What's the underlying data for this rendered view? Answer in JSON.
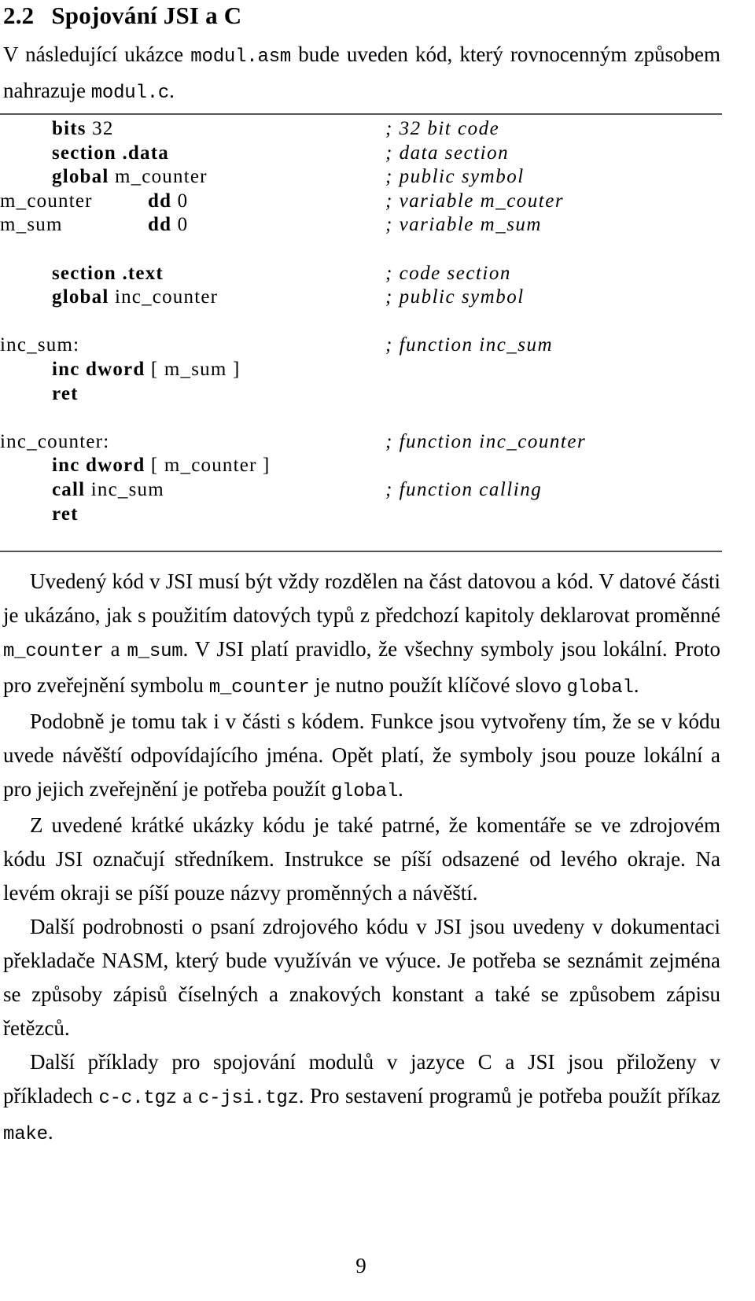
{
  "heading": {
    "number": "2.2",
    "title": "Spojování JSI a C"
  },
  "intro": {
    "part1": "V následující ukázce ",
    "code1": "modul.asm",
    "part2": " bude uveden kód, který rovnocenným způsobem nahrazuje ",
    "code2": "modul.c",
    "part3": "."
  },
  "listing": {
    "lines": [
      {
        "label": "",
        "op": "bits",
        "arg": " 32",
        "comment": "; 32 bit code"
      },
      {
        "label": "",
        "op": "section",
        "arg": " .data",
        "comment": "; data section"
      },
      {
        "label": "",
        "op": "global",
        "arg": " m_counter",
        "comment": "; public symbol"
      },
      {
        "label": "m_counter",
        "op": "dd",
        "arg": " 0",
        "comment": "; variable m_couter"
      },
      {
        "label": "m_sum",
        "op": "dd",
        "arg": " 0",
        "comment": "; variable m_sum"
      },
      {
        "label": "",
        "op": "",
        "arg": "",
        "comment": ""
      },
      {
        "label": "",
        "op": "section",
        "arg": " .text",
        "comment": "; code section"
      },
      {
        "label": "",
        "op": "global",
        "arg": " inc_counter",
        "comment": "; public symbol"
      },
      {
        "label": "",
        "op": "",
        "arg": "",
        "comment": ""
      },
      {
        "label": "inc_sum:",
        "op": "",
        "arg": "",
        "comment": "; function inc_sum"
      },
      {
        "label": "",
        "op": "inc dword",
        "arg": " [ m_sum ]",
        "comment": ""
      },
      {
        "label": "",
        "op": "ret",
        "arg": "",
        "comment": ""
      },
      {
        "label": "",
        "op": "",
        "arg": "",
        "comment": ""
      },
      {
        "label": "inc_counter:",
        "op": "",
        "arg": "",
        "comment": "; function inc_counter"
      },
      {
        "label": "",
        "op": "inc dword",
        "arg": " [ m_counter ]",
        "comment": ""
      },
      {
        "label": "",
        "op": "call",
        "arg": " inc_sum",
        "comment": "; function calling"
      },
      {
        "label": "",
        "op": "ret",
        "arg": "",
        "comment": ""
      }
    ]
  },
  "body": {
    "p1": {
      "t1": "Uvedený kód v JSI musí být vždy rozdělen na část datovou a kód. V datové části je ukázáno, jak s použitím datových typů z předchozí kapitoly deklarovat proměnné ",
      "c1": "m_counter",
      "t2": " a ",
      "c2": "m_sum",
      "t3": ". V JSI platí pravidlo, že všechny symboly jsou lokální. Proto pro zveřejnění symbolu ",
      "c3": "m_counter",
      "t4": " je nutno použít klíčové slovo ",
      "c4": "global",
      "t5": "."
    },
    "p2": {
      "t1": "Podobně je tomu tak i v části s kódem. Funkce jsou vytvořeny tím, že se v kódu uvede návěští odpovídajícího jména. Opět platí, že symboly jsou pouze lokální a pro jejich zveřejnění je potřeba použít ",
      "c1": "global",
      "t2": "."
    },
    "p3": {
      "t1": "Z uvedené krátké ukázky kódu je také patrné, že komentáře se ve zdrojovém kódu JSI označují středníkem. Instrukce se píší odsazené od levého okraje. Na levém okraji se píší pouze názvy proměnných a návěští."
    },
    "p4": {
      "t1": "Další podrobnosti o psaní zdrojového kódu v JSI jsou uvedeny v dokumentaci překladače NASM, který bude využíván ve výuce. Je potřeba se seznámit zejména se způsoby zápisů číselných a znakových konstant a také se způsobem zápisu řetězců."
    },
    "p5": {
      "t1": "Další příklady pro spojování modulů v jazyce C a JSI jsou přiloženy v příkladech ",
      "c1": "c-c.tgz",
      "t2": " a ",
      "c2": "c-jsi.tgz",
      "t3": ". Pro sestavení programů je potřeba použít příkaz ",
      "c3": "make",
      "t4": "."
    }
  },
  "footer": {
    "page_number": "9"
  }
}
